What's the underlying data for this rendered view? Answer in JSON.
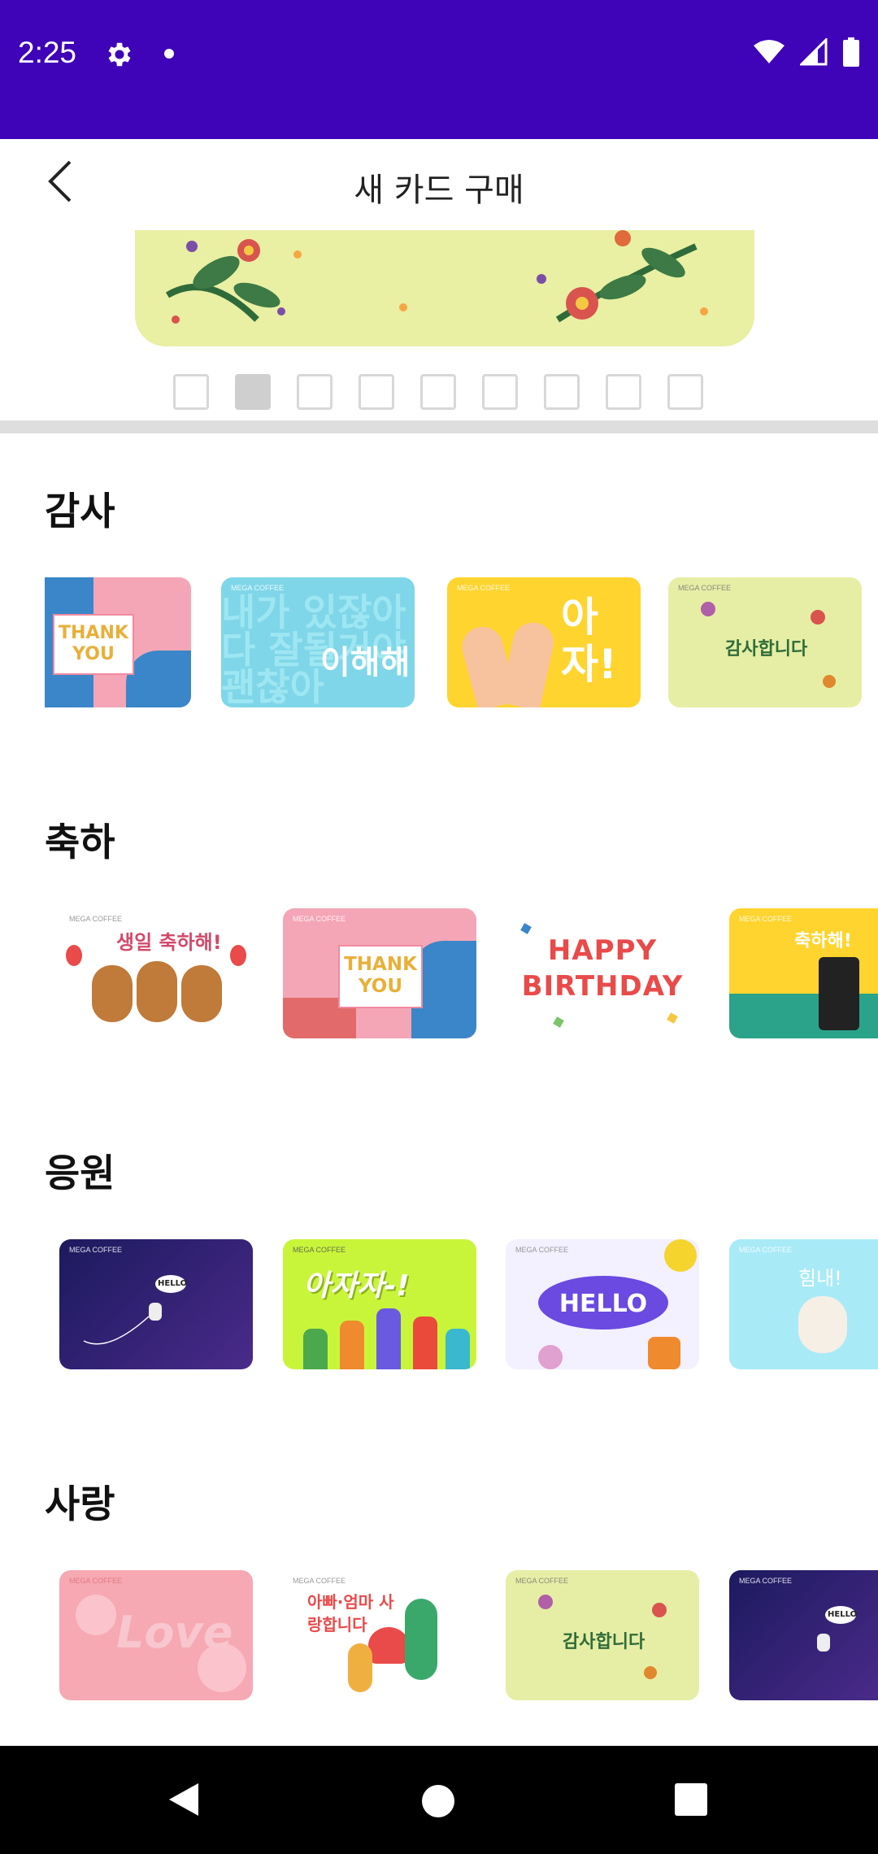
{
  "status_bar": {
    "time": "2:25"
  },
  "header": {
    "title": "새 카드 구매"
  },
  "carousel": {
    "pages": 9,
    "active_index": 1
  },
  "sections": [
    {
      "title": "감사",
      "cards": [
        {
          "brand": "",
          "text": "THANK YOU",
          "color": "#f4a6b6"
        },
        {
          "brand": "MEGA COFFEE",
          "text": "이해해",
          "color": "#7fd6e8"
        },
        {
          "brand": "MEGA COFFEE",
          "text": "아자!",
          "color": "#ffd42e"
        },
        {
          "brand": "MEGA COFFEE",
          "text": "감사합니다",
          "color": "#e6eea5"
        }
      ]
    },
    {
      "title": "축하",
      "cards": [
        {
          "brand": "MEGA COFFEE",
          "text": "생일 축하해!",
          "color": "#ffffff"
        },
        {
          "brand": "MEGA COFFEE",
          "text": "THANK YOU",
          "color": "#f4a6b6"
        },
        {
          "brand": "",
          "text": "HAPPY BIRTHDAY",
          "color": "#ffffff"
        },
        {
          "brand": "MEGA COFFEE",
          "text": "축하해!",
          "color": "#ffd42e"
        }
      ]
    },
    {
      "title": "응원",
      "cards": [
        {
          "brand": "MEGA COFFEE",
          "text": "HELLO",
          "color": "#2a1a6e"
        },
        {
          "brand": "MEGA COFFEE",
          "text": "아자자-!",
          "color": "#c8f53a"
        },
        {
          "brand": "MEGA COFFEE",
          "text": "HELLO",
          "color": "#f3f0ff"
        },
        {
          "brand": "MEGA COFFEE",
          "text": "힘내!",
          "color": "#a9eaf7"
        }
      ]
    },
    {
      "title": "사랑",
      "cards": [
        {
          "brand": "MEGA COFFEE",
          "text": "Love",
          "color": "#f6a9b2"
        },
        {
          "brand": "MEGA COFFEE",
          "text": "아빠·엄마 사랑합니다",
          "color": "#ffffff"
        },
        {
          "brand": "MEGA COFFEE",
          "text": "감사합니다",
          "color": "#e6eea5"
        },
        {
          "brand": "MEGA COFFEE",
          "text": "HELLO",
          "color": "#2a1a6e"
        }
      ]
    }
  ]
}
